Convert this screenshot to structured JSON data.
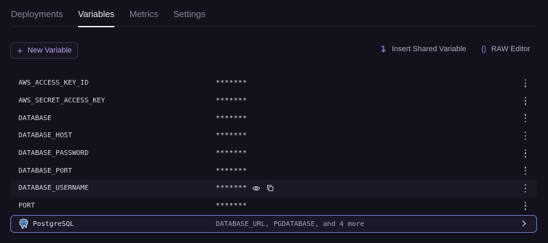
{
  "tabs": [
    {
      "label": "Deployments",
      "active": false
    },
    {
      "label": "Variables",
      "active": true
    },
    {
      "label": "Metrics",
      "active": false
    },
    {
      "label": "Settings",
      "active": false
    }
  ],
  "toolbar": {
    "new_variable_label": "New Variable",
    "insert_shared_label": "Insert Shared Variable",
    "raw_editor_label": "RAW Editor",
    "raw_editor_icon_text": "{}"
  },
  "variables": [
    {
      "name": "AWS_ACCESS_KEY_ID",
      "value": "*******"
    },
    {
      "name": "AWS_SECRET_ACCESS_KEY",
      "value": "*******"
    },
    {
      "name": "DATABASE",
      "value": "*******"
    },
    {
      "name": "DATABASE_HOST",
      "value": "*******"
    },
    {
      "name": "DATABASE_PASSWORD",
      "value": "*******"
    },
    {
      "name": "DATABASE_PORT",
      "value": "*******"
    },
    {
      "name": "DATABASE_USERNAME",
      "value": "*******",
      "hovered": true
    },
    {
      "name": "PORT",
      "value": "*******"
    }
  ],
  "plugin": {
    "name": "PostgreSQL",
    "variables_summary": "DATABASE_URL, PGDATABASE, and 4 more",
    "icon": "postgresql-elephant-icon"
  },
  "icons": {
    "new_variable": "plus-icon",
    "insert_shared": "corner-arrow-icon",
    "raw_editor": "braces-icon",
    "row_menu": "kebab-menu-icon",
    "reveal": "eye-icon",
    "copy": "copy-icon",
    "expand": "chevron-right-icon"
  },
  "colors": {
    "background": "#13111c",
    "accent": "#9a7cf2",
    "plugin_border": "#6f7bd6"
  }
}
